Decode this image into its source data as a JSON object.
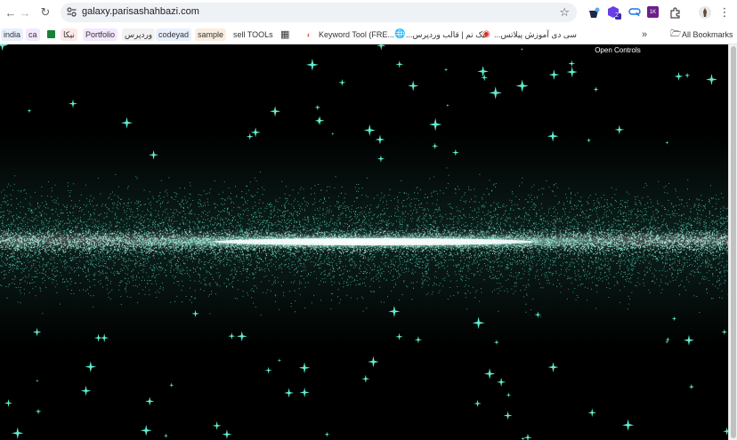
{
  "browser": {
    "url": "galaxy.parisashahbazi.com",
    "extension_badge": "2",
    "extension_label": "1K",
    "bookmarks": [
      {
        "label": "india",
        "color": "#1a73e8"
      },
      {
        "label": "ca",
        "color": "#9334e6"
      },
      {
        "label": "",
        "color": "#188038"
      },
      {
        "label": "نیکا",
        "color": "#d93025"
      },
      {
        "label": "Portfolio",
        "color": "#9334e6"
      },
      {
        "label": "وردپرس",
        "color": "#333333"
      },
      {
        "label": "codeyad",
        "color": "#1a73e8"
      },
      {
        "label": "sample",
        "color": "#5f3a1a"
      },
      {
        "label": "sell TOOLs",
        "color": "#333333"
      },
      {
        "label": "Keyword Tool (FRE...",
        "color": "#333333"
      },
      {
        "label": "تیک تم | قالب وردپرس...",
        "color": "#333333"
      },
      {
        "label": "سی دی آموزش پیلاتس...",
        "color": "#333333"
      }
    ],
    "all_bookmarks": "All Bookmarks"
  },
  "page": {
    "open_controls": "Open Controls",
    "star_color": "#5ff0d0",
    "core_color": "#ffffff"
  }
}
